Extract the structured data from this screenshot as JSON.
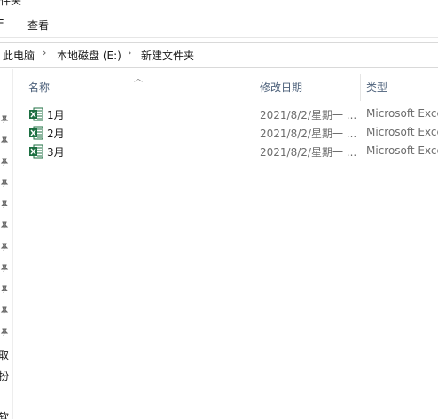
{
  "window": {
    "title_fragment": "件夹"
  },
  "ribbon": {
    "tab_left_fragment": "E",
    "tab_view": "查看"
  },
  "breadcrumb": {
    "items": [
      "此电脑",
      "本地磁盘 (E:)",
      "新建文件夹"
    ],
    "separator": "›"
  },
  "columns": {
    "name": "名称",
    "date": "修改日期",
    "type": "类型"
  },
  "files": [
    {
      "name": "1月",
      "date": "2021/8/2/星期一 ...",
      "type": "Microsoft Excel"
    },
    {
      "name": "2月",
      "date": "2021/8/2/星期一 ...",
      "type": "Microsoft Excel"
    },
    {
      "name": "3月",
      "date": "2021/8/2/星期一 ...",
      "type": "Microsoft Excel"
    }
  ],
  "navpane": {
    "text_a": "取",
    "text_b": "扮",
    "text_c": "软"
  },
  "icons": {
    "file": "excel-file-icon",
    "pin": "pin-icon",
    "sort": "sort-up-caret-icon"
  },
  "colors": {
    "excel_green": "#1d6f42",
    "header_text": "#4c607a"
  }
}
